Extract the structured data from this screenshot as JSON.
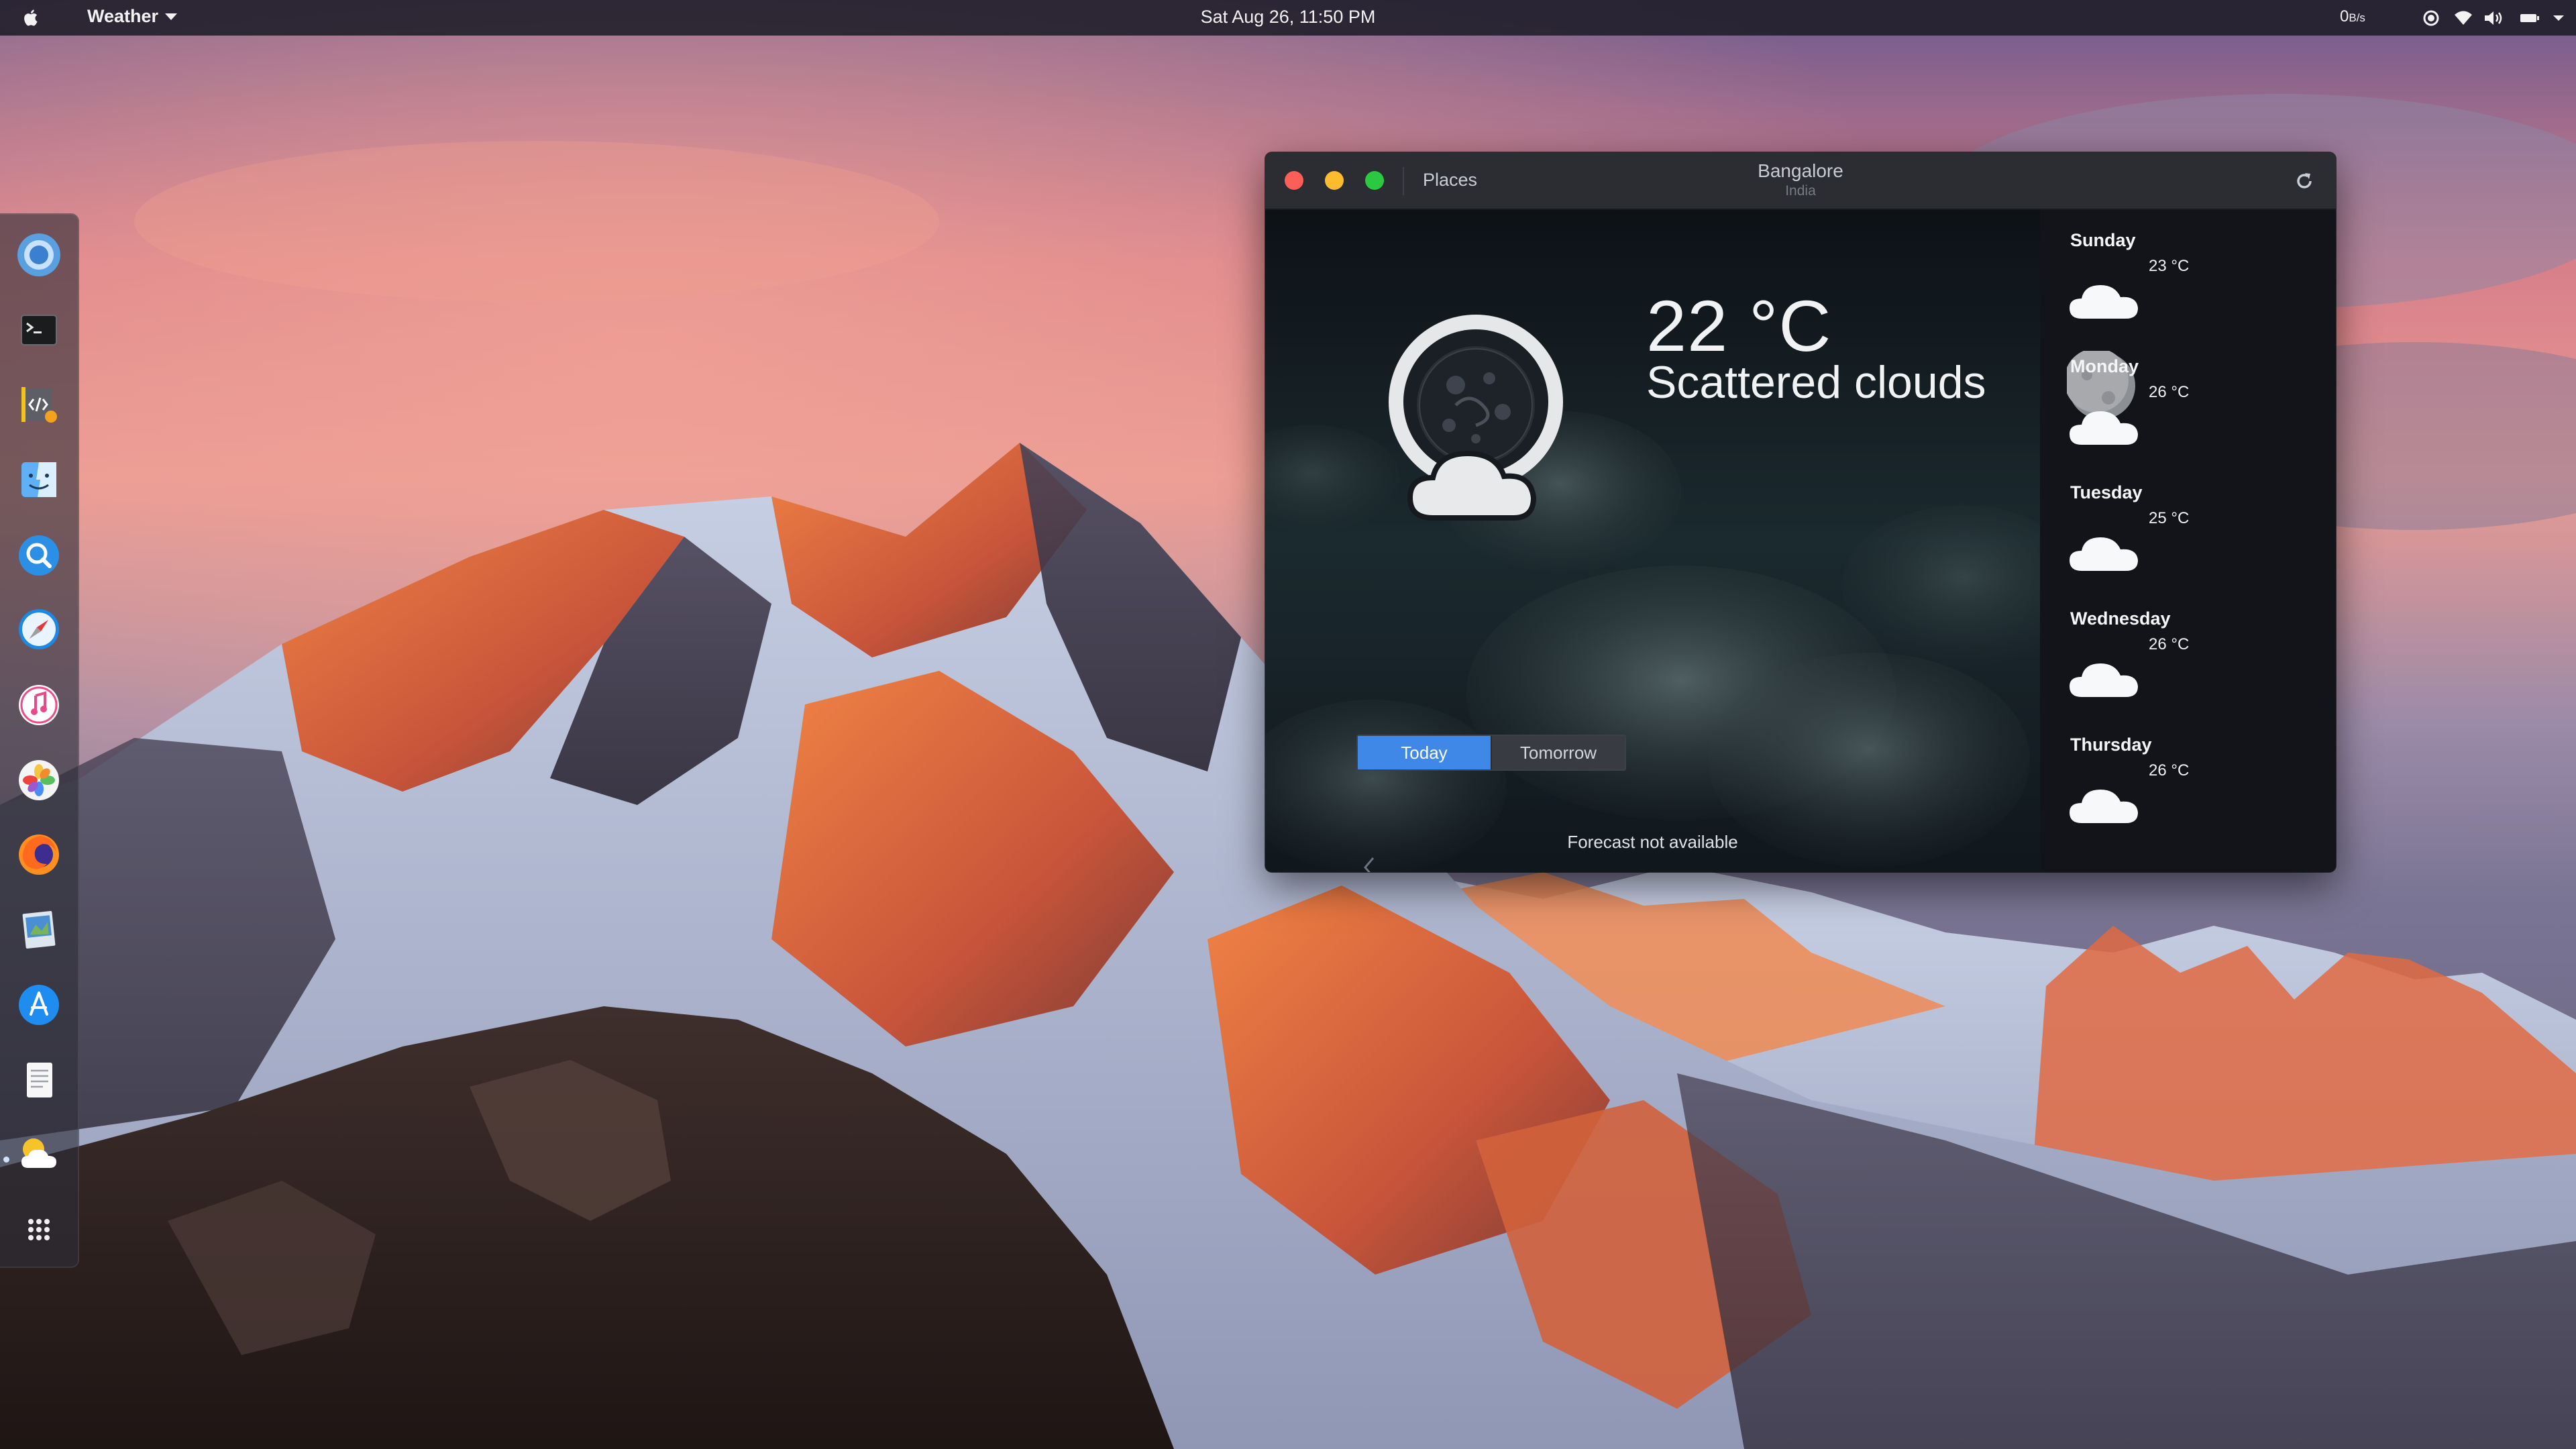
{
  "menubar": {
    "app_name": "Weather",
    "clock": "Sat Aug 26, 11:50 PM",
    "net_speed_value": "0",
    "net_speed_unit": "B/s"
  },
  "dock": {
    "items": [
      "chromium",
      "terminal",
      "code-editor",
      "finder",
      "search",
      "safari",
      "itunes",
      "photos",
      "firefox",
      "preview",
      "app-store",
      "text-editor",
      "weather",
      "app-launcher"
    ],
    "active": "weather"
  },
  "window": {
    "places_label": "Places",
    "city": "Bangalore",
    "country": "India",
    "current": {
      "temperature": "22 °C",
      "condition": "Scattered clouds"
    },
    "toggle": {
      "today_label": "Today",
      "tomorrow_label": "Tomorrow",
      "selected": "Today"
    },
    "forecast_message": "Forecast not available",
    "daily": [
      {
        "day": "Sunday",
        "temp": "23 °C",
        "icon": "cloud-icon"
      },
      {
        "day": "Monday",
        "temp": "26 °C",
        "icon": "cloud-icon"
      },
      {
        "day": "Tuesday",
        "temp": "25 °C",
        "icon": "cloud-icon"
      },
      {
        "day": "Wednesday",
        "temp": "26 °C",
        "icon": "cloud-icon"
      },
      {
        "day": "Thursday",
        "temp": "26 °C",
        "icon": "cloud-icon"
      }
    ]
  },
  "colors": {
    "accent": "#3f88e8",
    "close": "#fc5f57",
    "minimize": "#fdbb2e",
    "maximize": "#2ac941"
  }
}
